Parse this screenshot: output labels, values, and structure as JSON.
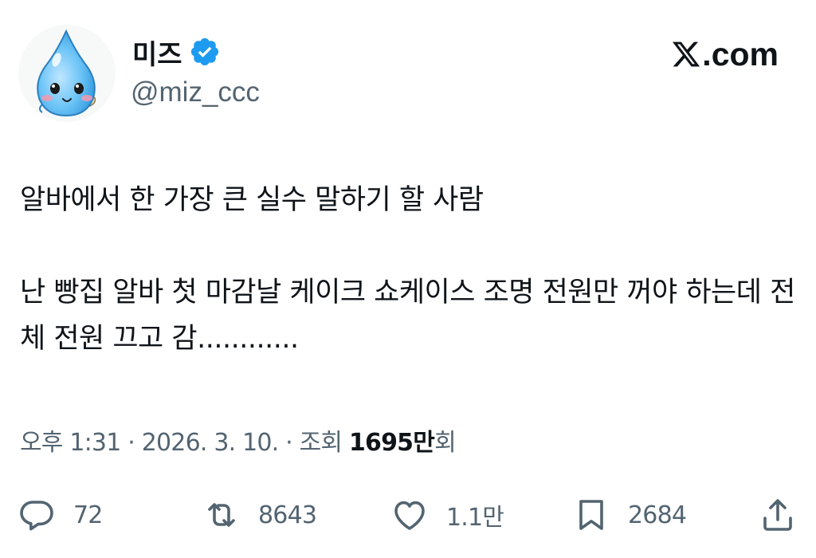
{
  "user": {
    "display_name": "미즈",
    "handle": "@miz_ccc",
    "verified_color": "#1d9bf0"
  },
  "brand": {
    "text": ".com"
  },
  "tweet": {
    "paragraphs": [
      "알바에서 한 가장 큰 실수 말하기 할 사람",
      "난 빵집 알바 첫 마감날 케이크 쇼케이스 조명 전원만 꺼야 하는데 전체 전원 끄고 감............"
    ]
  },
  "meta": {
    "prefix": "오후 1:31 · 2026. 3. 10. · 조회 ",
    "views_value": "1695만",
    "views_suffix": "회"
  },
  "actions": {
    "replies": "72",
    "retweets": "8643",
    "likes": "1.1만",
    "bookmarks": "2684"
  },
  "colors": {
    "text_primary": "#0f1419",
    "text_secondary": "#536471",
    "accent": "#1d9bf0"
  },
  "icons": [
    "verified-badge-icon",
    "x-logo-icon",
    "reply-icon",
    "retweet-icon",
    "like-icon",
    "bookmark-icon",
    "share-icon"
  ]
}
